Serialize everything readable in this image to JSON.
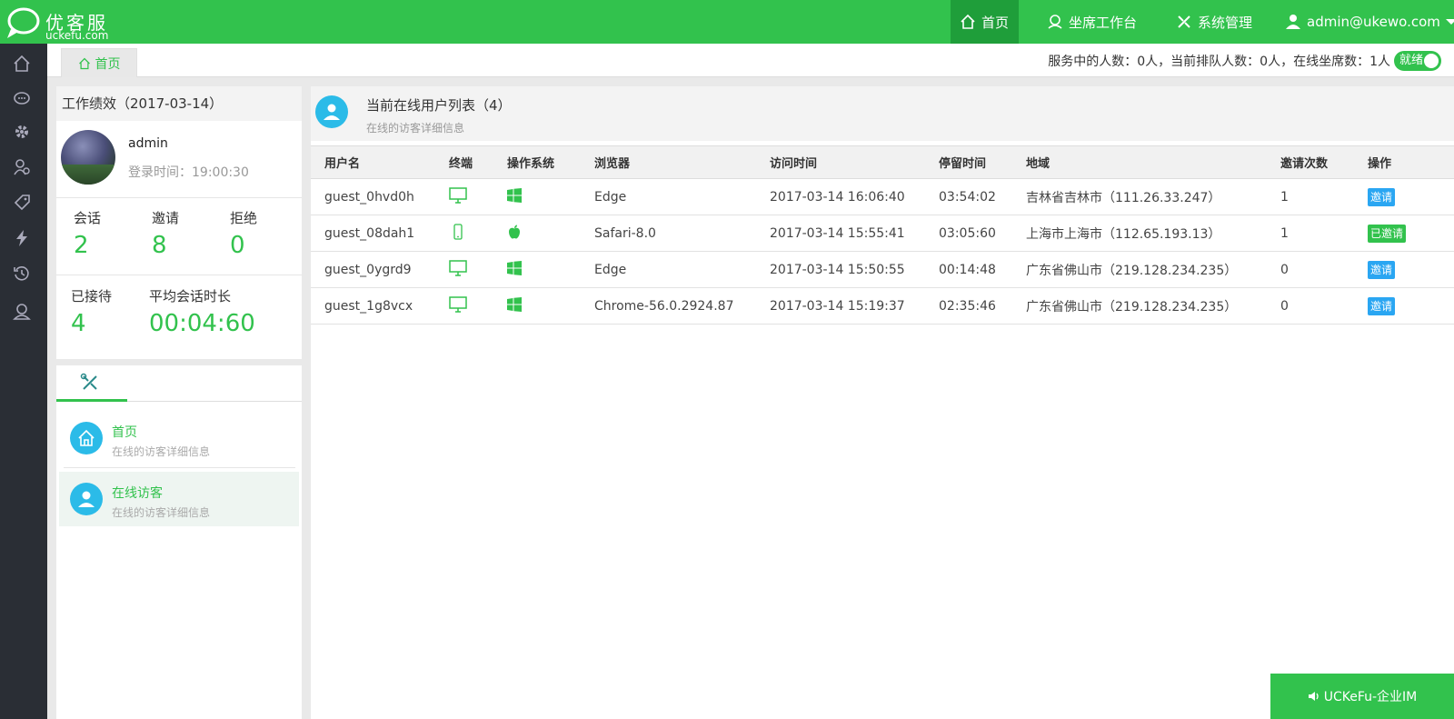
{
  "brand": {
    "name": "优客服",
    "domain": "uckefu.com"
  },
  "topnav": {
    "home": "首页",
    "agent": "坐席工作台",
    "system": "系统管理",
    "user": "admin@ukewo.com"
  },
  "tabbar": {
    "tab_home": "首页",
    "status": "服务中的人数：0人，当前排队人数：0人，在线坐席数：1人",
    "toggle_label": "就绪"
  },
  "perf": {
    "title": "工作绩效（2017-03-14）",
    "username": "admin",
    "login_time": "登录时间：19:00:30",
    "stats": {
      "session_label": "会话",
      "session_value": "2",
      "invite_label": "邀请",
      "invite_value": "8",
      "reject_label": "拒绝",
      "reject_value": "0",
      "received_label": "已接待",
      "received_value": "4",
      "avg_label": "平均会话时长",
      "avg_value": "00:04:60"
    }
  },
  "tools": {
    "items": [
      {
        "title": "首页",
        "desc": "在线的访客详细信息"
      },
      {
        "title": "在线访客",
        "desc": "在线的访客详细信息"
      }
    ]
  },
  "main": {
    "title": "当前在线用户列表（4）",
    "subtitle": "在线的访客详细信息",
    "columns": [
      "用户名",
      "终端",
      "操作系统",
      "浏览器",
      "访问时间",
      "停留时间",
      "地域",
      "邀请次数",
      "操作"
    ],
    "rows": [
      {
        "user": "guest_0hvd0h",
        "terminal": "desktop",
        "os": "windows",
        "browser": "Edge",
        "visit": "2017-03-14 16:06:40",
        "stay": "03:54:02",
        "region": "吉林省吉林市（111.26.33.247）",
        "invites": "1",
        "action": "邀请"
      },
      {
        "user": "guest_08dah1",
        "terminal": "mobile",
        "os": "apple",
        "browser": "Safari-8.0",
        "visit": "2017-03-14 15:55:41",
        "stay": "03:05:60",
        "region": "上海市上海市（112.65.193.13）",
        "invites": "1",
        "action": "已邀请"
      },
      {
        "user": "guest_0ygrd9",
        "terminal": "desktop",
        "os": "windows",
        "browser": "Edge",
        "visit": "2017-03-14 15:50:55",
        "stay": "00:14:48",
        "region": "广东省佛山市（219.128.234.235）",
        "invites": "0",
        "action": "邀请"
      },
      {
        "user": "guest_1g8vcx",
        "terminal": "desktop",
        "os": "windows",
        "browser": "Chrome-56.0.2924.87",
        "visit": "2017-03-14 15:19:37",
        "stay": "02:35:46",
        "region": "广东省佛山市（219.128.234.235）",
        "invites": "0",
        "action": "邀请"
      }
    ]
  },
  "im_bar": {
    "label": "UCKeFu-企业IM"
  },
  "colors": {
    "primary": "#32c24d",
    "sidebar": "#2a2e35",
    "info": "#2bbbe8",
    "button_blue": "#2aa6f2"
  }
}
